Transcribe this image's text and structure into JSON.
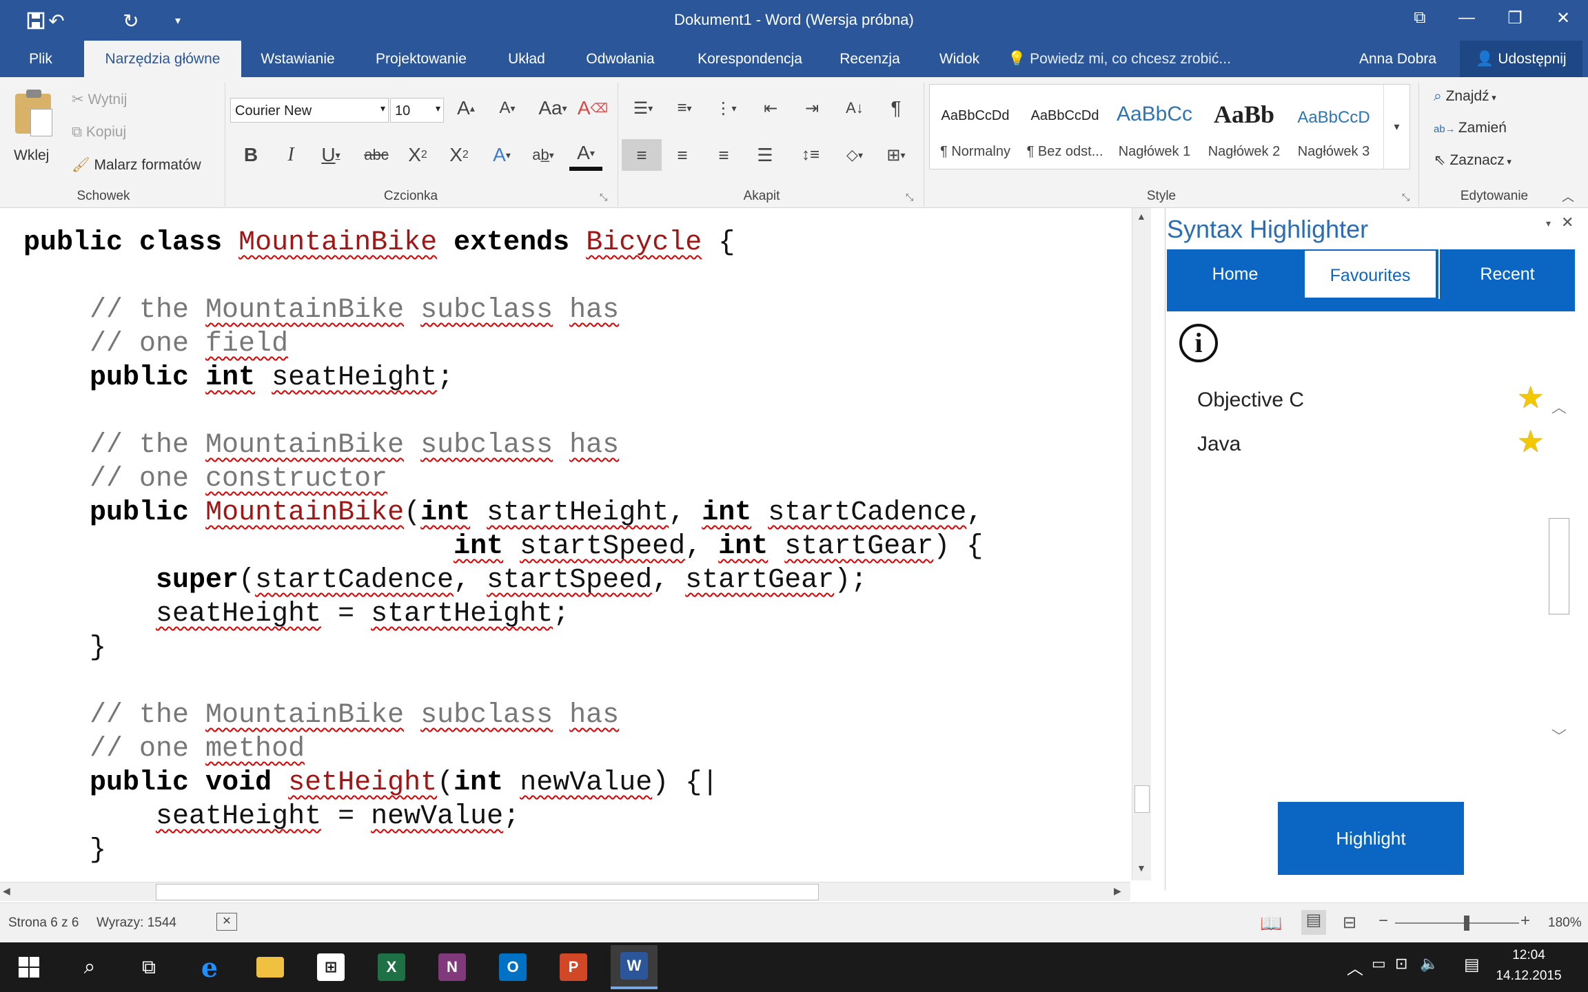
{
  "window": {
    "title": "Dokument1 - Word (Wersja próbna)"
  },
  "tabs": [
    {
      "label": "Plik"
    },
    {
      "label": "Narzędzia główne"
    },
    {
      "label": "Wstawianie"
    },
    {
      "label": "Projektowanie"
    },
    {
      "label": "Układ"
    },
    {
      "label": "Odwołania"
    },
    {
      "label": "Korespondencja"
    },
    {
      "label": "Recenzja"
    },
    {
      "label": "Widok"
    }
  ],
  "tell_me": "Powiedz mi, co chcesz zrobić...",
  "user": "Anna Dobra",
  "share_label": "Udostępnij",
  "ribbon": {
    "clipboard": {
      "paste": "Wklej",
      "cut": "Wytnij",
      "copy": "Kopiuj",
      "painter": "Malarz formatów",
      "group": "Schowek"
    },
    "font": {
      "name": "Courier New",
      "size": "10",
      "group": "Czcionka"
    },
    "paragraph": {
      "group": "Akapit"
    },
    "styles": {
      "group": "Style",
      "items": [
        {
          "sample": "AaBbCcDd",
          "name": "¶ Normalny"
        },
        {
          "sample": "AaBbCcDd",
          "name": "¶ Bez odst..."
        },
        {
          "sample": "AaBbCc",
          "name": "Nagłówek 1"
        },
        {
          "sample": "AaBb",
          "name": "Nagłówek 2"
        },
        {
          "sample": "AaBbCcD",
          "name": "Nagłówek 3"
        }
      ]
    },
    "editing": {
      "find": "Znajdź",
      "replace": "Zamień",
      "select": "Zaznacz",
      "group": "Edytowanie"
    }
  },
  "pane": {
    "title": "Syntax Highlighter",
    "tabs": [
      "Home",
      "Favourites",
      "Recent"
    ],
    "languages": [
      "Objective C",
      "Java"
    ],
    "button": "Highlight"
  },
  "status": {
    "page": "Strona 6 z 6",
    "words": "Wyrazy: 1544",
    "zoom": "180%"
  },
  "clock": {
    "time": "12:04",
    "date": "14.12.2015"
  },
  "code_lines": [
    [
      {
        "t": "public",
        "c": "kw"
      },
      {
        "t": " "
      },
      {
        "t": "class",
        "c": "kw"
      },
      {
        "t": " "
      },
      {
        "t": "MountainBike",
        "c": "cls wv"
      },
      {
        "t": " "
      },
      {
        "t": "extends",
        "c": "kw"
      },
      {
        "t": " "
      },
      {
        "t": "Bicycle",
        "c": "cls wv"
      },
      {
        "t": " {"
      }
    ],
    [],
    [
      {
        "t": "    // the ",
        "c": "cm"
      },
      {
        "t": "MountainBike",
        "c": "cm wv"
      },
      {
        "t": " ",
        "c": "cm"
      },
      {
        "t": "subclass",
        "c": "cm wv"
      },
      {
        "t": " ",
        "c": "cm"
      },
      {
        "t": "has",
        "c": "cm wv"
      }
    ],
    [
      {
        "t": "    // one ",
        "c": "cm"
      },
      {
        "t": "field",
        "c": "cm wv"
      }
    ],
    [
      {
        "t": "    "
      },
      {
        "t": "public",
        "c": "kw"
      },
      {
        "t": " "
      },
      {
        "t": "int",
        "c": "kw wv"
      },
      {
        "t": " "
      },
      {
        "t": "seatHeight",
        "c": "wv"
      },
      {
        "t": ";"
      }
    ],
    [],
    [
      {
        "t": "    // the ",
        "c": "cm"
      },
      {
        "t": "MountainBike",
        "c": "cm wv"
      },
      {
        "t": " ",
        "c": "cm"
      },
      {
        "t": "subclass",
        "c": "cm wv"
      },
      {
        "t": " ",
        "c": "cm"
      },
      {
        "t": "has",
        "c": "cm wv"
      }
    ],
    [
      {
        "t": "    // one ",
        "c": "cm"
      },
      {
        "t": "constructor",
        "c": "cm wv"
      }
    ],
    [
      {
        "t": "    "
      },
      {
        "t": "public",
        "c": "kw"
      },
      {
        "t": " "
      },
      {
        "t": "MountainBike",
        "c": "cls wv"
      },
      {
        "t": "("
      },
      {
        "t": "int",
        "c": "kw wv"
      },
      {
        "t": " "
      },
      {
        "t": "startHeight",
        "c": "wv"
      },
      {
        "t": ", "
      },
      {
        "t": "int",
        "c": "kw wv"
      },
      {
        "t": " "
      },
      {
        "t": "startCadence",
        "c": "wv"
      },
      {
        "t": ","
      }
    ],
    [
      {
        "t": "                          "
      },
      {
        "t": "int",
        "c": "kw wv"
      },
      {
        "t": " "
      },
      {
        "t": "startSpeed",
        "c": "wv"
      },
      {
        "t": ", "
      },
      {
        "t": "int",
        "c": "kw wv"
      },
      {
        "t": " "
      },
      {
        "t": "startGear",
        "c": "wv"
      },
      {
        "t": ") {"
      }
    ],
    [
      {
        "t": "        "
      },
      {
        "t": "super",
        "c": "kw"
      },
      {
        "t": "("
      },
      {
        "t": "startCadence",
        "c": "wv"
      },
      {
        "t": ", "
      },
      {
        "t": "startSpeed",
        "c": "wv"
      },
      {
        "t": ", "
      },
      {
        "t": "startGear",
        "c": "wv"
      },
      {
        "t": ");"
      }
    ],
    [
      {
        "t": "        "
      },
      {
        "t": "seatHeight",
        "c": "wv"
      },
      {
        "t": " = "
      },
      {
        "t": "startHeight",
        "c": "wv"
      },
      {
        "t": ";"
      }
    ],
    [
      {
        "t": "    }"
      }
    ],
    [],
    [
      {
        "t": "    // the ",
        "c": "cm"
      },
      {
        "t": "MountainBike",
        "c": "cm wv"
      },
      {
        "t": " ",
        "c": "cm"
      },
      {
        "t": "subclass",
        "c": "cm wv"
      },
      {
        "t": " ",
        "c": "cm"
      },
      {
        "t": "has",
        "c": "cm wv"
      }
    ],
    [
      {
        "t": "    // one ",
        "c": "cm"
      },
      {
        "t": "method",
        "c": "cm wv"
      }
    ],
    [
      {
        "t": "    "
      },
      {
        "t": "public",
        "c": "kw"
      },
      {
        "t": " "
      },
      {
        "t": "void",
        "c": "kw"
      },
      {
        "t": " "
      },
      {
        "t": "setHeight",
        "c": "cls wv"
      },
      {
        "t": "("
      },
      {
        "t": "int",
        "c": "kw"
      },
      {
        "t": " "
      },
      {
        "t": "newValue",
        "c": "wv"
      },
      {
        "t": ") {|"
      }
    ],
    [
      {
        "t": "        "
      },
      {
        "t": "seatHeight",
        "c": "wv"
      },
      {
        "t": " = "
      },
      {
        "t": "newValue",
        "c": "wv"
      },
      {
        "t": ";"
      }
    ],
    [
      {
        "t": "    }"
      }
    ]
  ]
}
